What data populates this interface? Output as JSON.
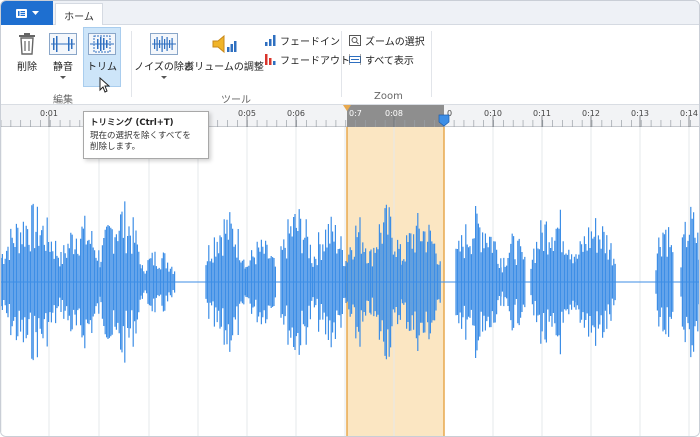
{
  "tabs": {
    "home": "ホーム"
  },
  "ribbon": {
    "tools": {
      "delete": "削除",
      "silence": "静音",
      "trim": "トリム",
      "noise": "ノイズの除去",
      "volume": "ボリュームの調整",
      "fade_in": "フェードイン",
      "fade_out": "フェードアウト",
      "zoom_select": "ズームの選択",
      "show_all": "すべて表示"
    },
    "groups": {
      "edit": "編集",
      "tools": "ツール",
      "zoom": "Zoom"
    }
  },
  "tooltip": {
    "title": "トリミング (Ctrl+T)",
    "line1": "現在の選択を除くすべてを",
    "line2": "削除します。"
  },
  "timeline": {
    "ticks": [
      "0:01",
      "0:05",
      "0:06",
      "0:08",
      "0:10",
      "0:11",
      "0:12",
      "0:13",
      "0:14"
    ],
    "partial_ticks": [
      "0:7",
      "0"
    ]
  },
  "colors": {
    "accent": "#1e6fd0",
    "wave": "#3d8ee6",
    "selection": "#fbe6c2",
    "selection_border": "#e8a94e"
  },
  "icons": {
    "file_menu": "document-icon",
    "delete": "trash-icon",
    "silence": "silence-waveform-icon",
    "trim": "trim-waveform-icon",
    "noise": "noise-waveform-icon",
    "volume": "speaker-icon",
    "fade_in": "fade-in-bars-icon",
    "fade_out": "fade-out-bars-icon",
    "zoom_select": "zoom-rectangle-icon",
    "show_all": "fit-all-icon"
  }
}
